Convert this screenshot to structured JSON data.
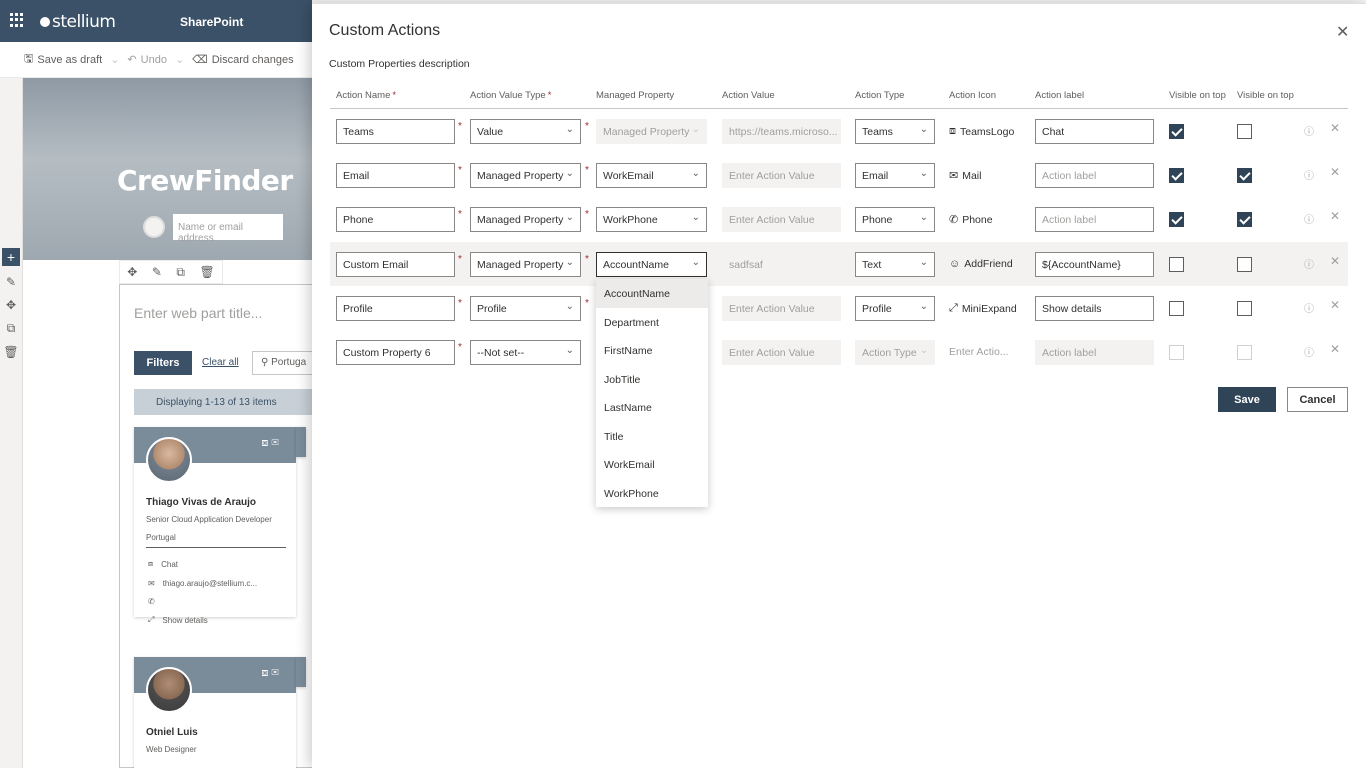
{
  "suite": {
    "logo": "stellium",
    "app": "SharePoint"
  },
  "commands": {
    "save_draft": "Save as draft",
    "undo": "Undo",
    "discard": "Discard changes"
  },
  "hero": {
    "title": "CrewFinder",
    "search_placeholder": "Name or email address"
  },
  "webpart": {
    "title_placeholder": "Enter web part title...",
    "filters": "Filters",
    "clear_all": "Clear all",
    "search_value": "Portuga",
    "displaying": "Displaying 1-13 of 13 items"
  },
  "cards": [
    {
      "name": "Thiago Vivas de Araujo",
      "job": "Senior Cloud Application Developer",
      "location": "Portugal",
      "chat": "Chat",
      "email": "thiago.araujo@stellium.c...",
      "details": "Show details"
    },
    {
      "name": "Otniel Luis",
      "job": "Web Designer"
    }
  ],
  "panel": {
    "title": "Custom Actions",
    "description": "Custom Properties description",
    "headers": {
      "action_name": "Action Name",
      "action_value_type": "Action Value Type",
      "managed_property": "Managed Property",
      "action_value": "Action Value",
      "action_type": "Action Type",
      "action_icon": "Action Icon",
      "action_label": "Action label",
      "visible_on_top_1": "Visible on top",
      "visible_on_top_2": "Visible on top"
    },
    "rows": [
      {
        "name": "Teams",
        "value_type": "Value",
        "managed_property": "Managed Property",
        "action_value": "https://teams.microso...",
        "action_type": "Teams",
        "icon": "TeamsLogo",
        "label": "Chat",
        "visible1": true,
        "visible2": false
      },
      {
        "name": "Email",
        "value_type": "Managed Property",
        "managed_property": "WorkEmail",
        "action_value": "Enter Action Value",
        "action_type": "Email",
        "icon": "Mail",
        "label": "Action label",
        "visible1": true,
        "visible2": true
      },
      {
        "name": "Phone",
        "value_type": "Managed Property",
        "managed_property": "WorkPhone",
        "action_value": "Enter Action Value",
        "action_type": "Phone",
        "icon": "Phone",
        "label": "Action label",
        "visible1": true,
        "visible2": true
      },
      {
        "name": "Custom Email",
        "value_type": "Managed Property",
        "managed_property": "AccountName",
        "action_value": "sadfsaf",
        "action_type": "Text",
        "icon": "AddFriend",
        "label": "${AccountName}",
        "visible1": false,
        "visible2": false
      },
      {
        "name": "Profile",
        "value_type": "Profile",
        "managed_property": "",
        "action_value": "Enter Action Value",
        "action_type": "Profile",
        "icon": "MiniExpand",
        "label": "Show details",
        "visible1": false,
        "visible2": false
      },
      {
        "name": "Custom Property 6",
        "value_type": "--Not set--",
        "managed_property": "",
        "action_value": "Enter Action Value",
        "action_type": "Action Type",
        "icon": "Enter Actio...",
        "label": "Action label",
        "visible1": false,
        "visible2": false
      }
    ],
    "dropdown_options": [
      "AccountName",
      "Department",
      "FirstName",
      "JobTitle",
      "LastName",
      "Title",
      "WorkEmail",
      "WorkPhone"
    ],
    "save": "Save",
    "cancel": "Cancel"
  }
}
